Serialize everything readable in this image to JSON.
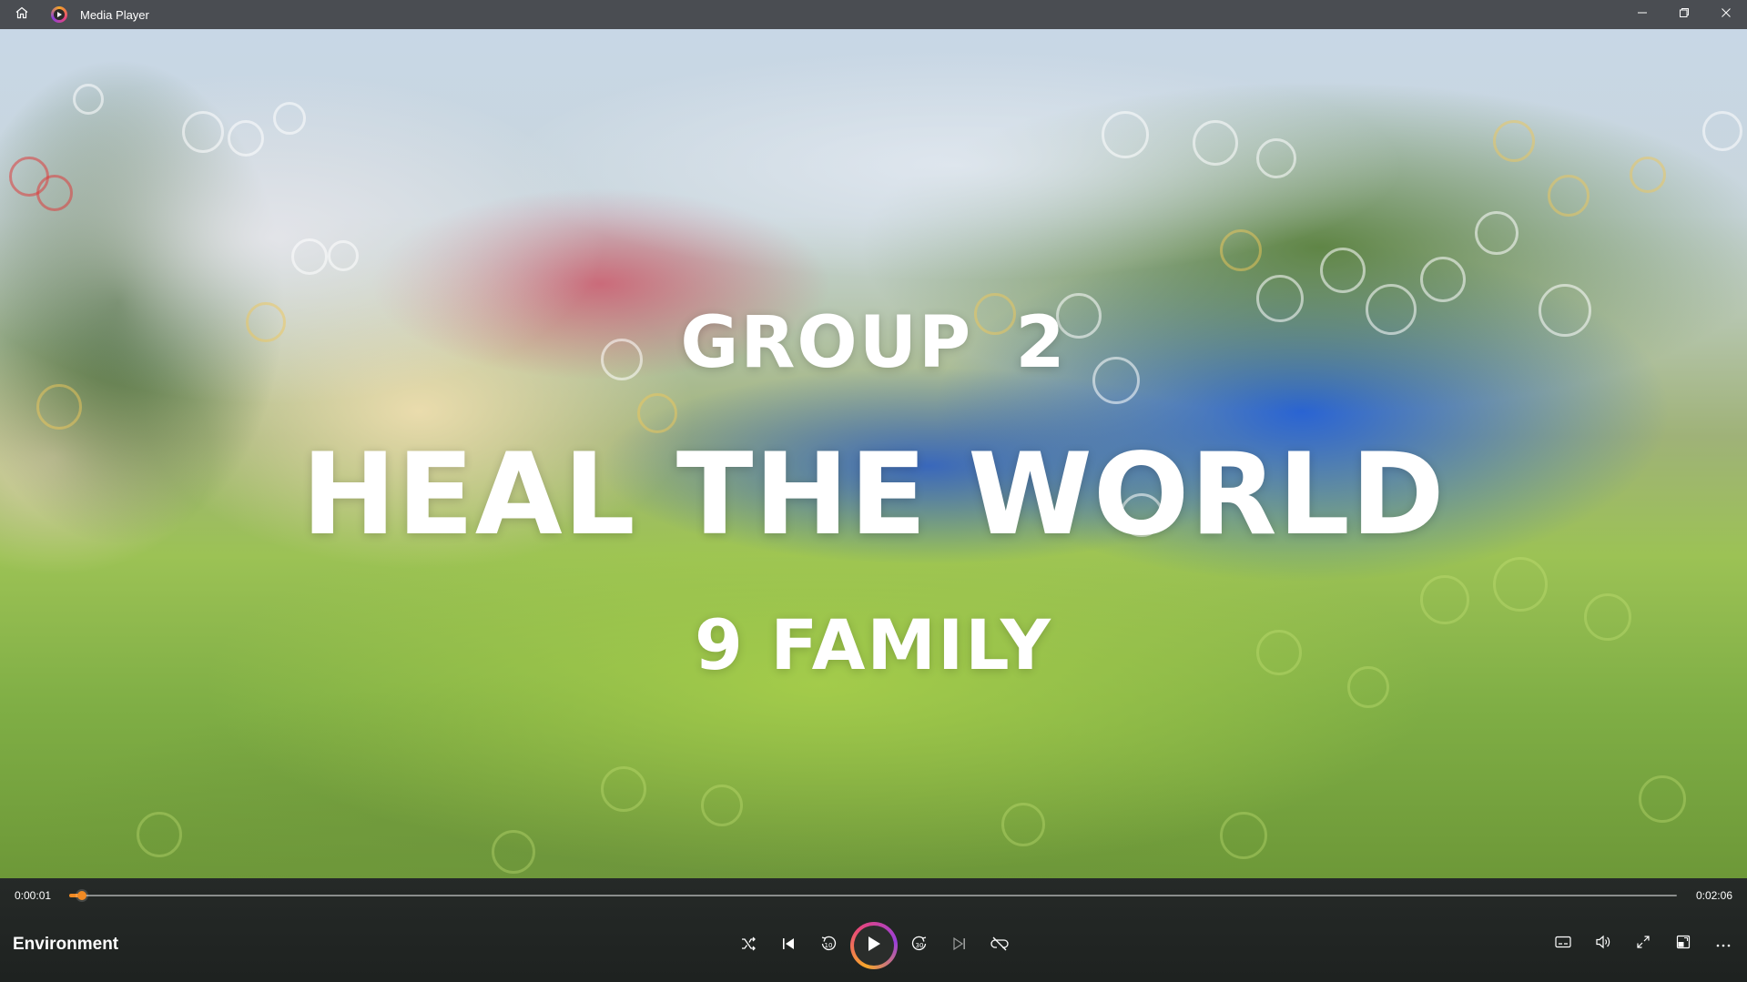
{
  "window": {
    "title": "Media Player",
    "icons": {
      "home": "home-icon",
      "app": "media-player-app-icon",
      "minimize": "minimize-icon",
      "restore": "restore-icon",
      "close": "close-icon"
    }
  },
  "video": {
    "line1": "GROUP  2",
    "line2": "HEAL THE WORLD",
    "line3": "9 FAMILY"
  },
  "playback": {
    "current_time": "0:00:01",
    "total_time": "0:02:06",
    "progress_fraction": 0.008,
    "media_title": "Environment",
    "state": "paused",
    "accent_color": "#f08a24"
  },
  "transport_icons": [
    "shuffle-icon",
    "previous-icon",
    "rewind-10-icon",
    "play-icon",
    "forward-30-icon",
    "next-icon",
    "repeat-off-icon"
  ],
  "right_tool_icons": [
    "subtitles-icon",
    "volume-icon",
    "fullscreen-icon",
    "mini-player-icon",
    "more-options-icon"
  ]
}
